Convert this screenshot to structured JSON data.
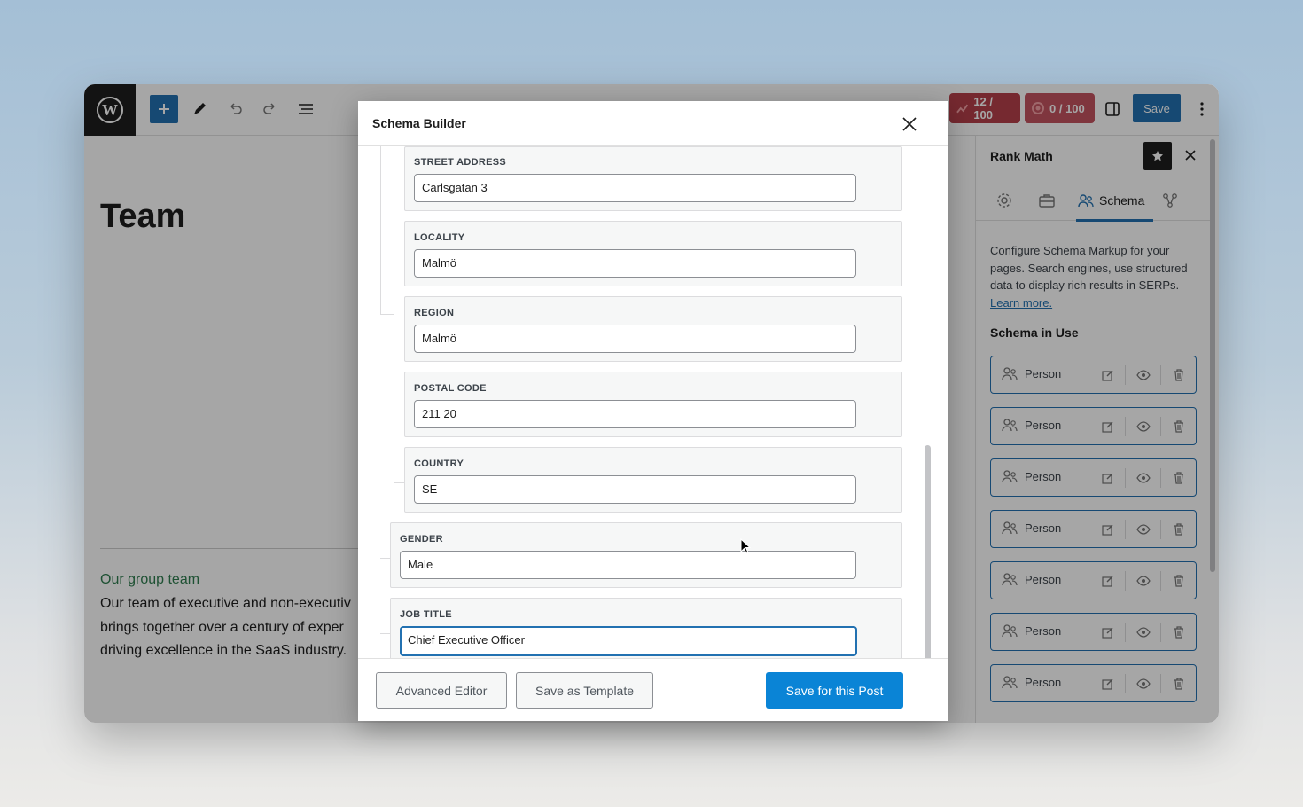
{
  "toolbar": {
    "seo_score": "12 / 100",
    "readability_score": "0 / 100",
    "save_label": "Save"
  },
  "editor": {
    "page_title": "Team",
    "subheading": "Our group team",
    "body_lines": [
      "Our team of executive and non-executiv",
      "brings together over a century of exper",
      "driving excellence in the SaaS industry."
    ]
  },
  "sidebar": {
    "title": "Rank Math",
    "tabs": [
      {
        "label": "Schema"
      }
    ],
    "description": "Configure Schema Markup for your pages. Search engines, use structured data to display rich results in SERPs.",
    "learn_more": "Learn more.",
    "in_use_heading": "Schema in Use",
    "schemas": [
      "Person",
      "Person",
      "Person",
      "Person",
      "Person",
      "Person",
      "Person"
    ]
  },
  "modal": {
    "title": "Schema Builder",
    "fields": {
      "street_address": {
        "label": "STREET ADDRESS",
        "value": "Carlsgatan 3"
      },
      "locality": {
        "label": "LOCALITY",
        "value": "Malmö"
      },
      "region": {
        "label": "REGION",
        "value": "Malmö"
      },
      "postal_code": {
        "label": "POSTAL CODE",
        "value": "211 20"
      },
      "country": {
        "label": "COUNTRY",
        "value": "SE"
      },
      "gender": {
        "label": "GENDER",
        "value": "Male"
      },
      "job_title": {
        "label": "JOB TITLE",
        "value": "Chief Executive Officer"
      }
    },
    "buttons": {
      "advanced_editor": "Advanced Editor",
      "save_template": "Save as Template",
      "save_post": "Save for this Post"
    }
  },
  "colors": {
    "primary": "#2271b1",
    "save_post": "#0a84d6",
    "score_bad": "#c63b3b"
  },
  "icons": [
    "wordpress-logo-icon",
    "plus-icon",
    "pencil-icon",
    "undo-icon",
    "redo-icon",
    "list-view-icon",
    "settings-icon",
    "more-icon",
    "star-icon",
    "close-icon",
    "gear-icon",
    "briefcase-icon",
    "users-icon",
    "share-icon",
    "edit-icon",
    "eye-icon",
    "trash-icon"
  ]
}
